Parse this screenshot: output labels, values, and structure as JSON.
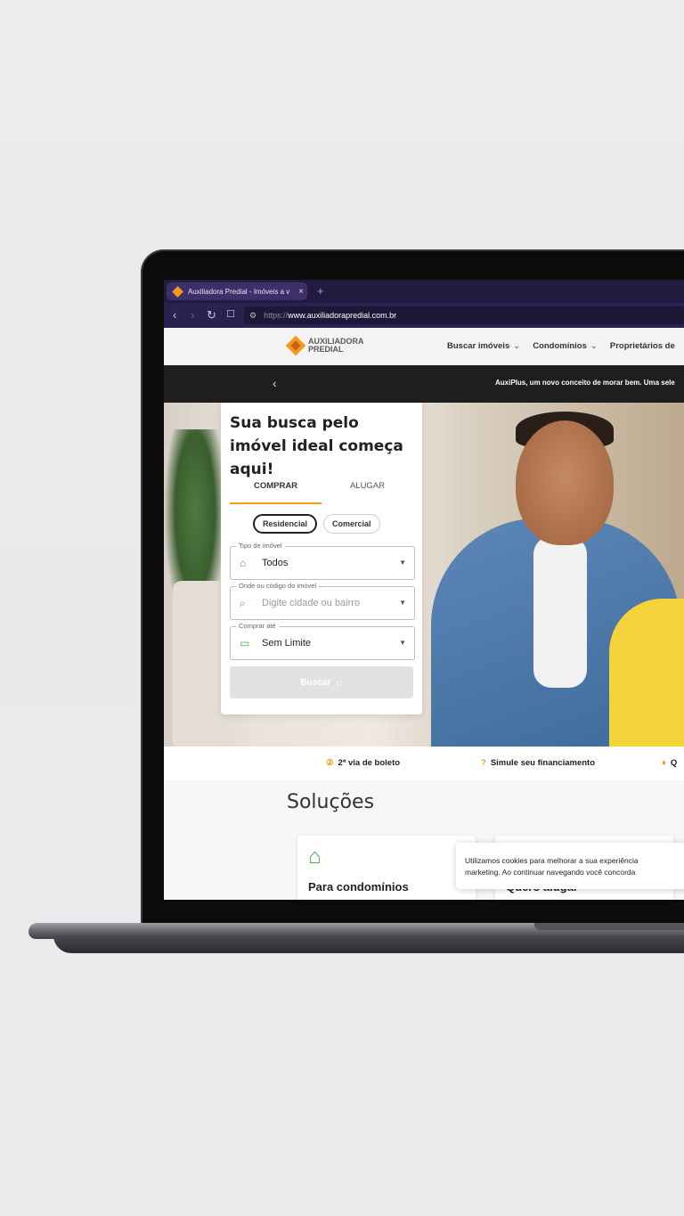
{
  "browser": {
    "tab_title": "Auxiliadora Predial - Imóveis a v",
    "tab_close": "×",
    "new_tab": "+",
    "url_proto": "https://",
    "url_host": "www.auxiliadorapredial.com.br"
  },
  "header": {
    "logo_line1": "AUXILIADORA",
    "logo_line2": "PREDIAL",
    "nav": [
      {
        "label": "Buscar imóveis",
        "chevron": "⌄"
      },
      {
        "label": "Condomínios",
        "chevron": "⌄"
      },
      {
        "label": "Proprietários de",
        "chevron": ""
      }
    ]
  },
  "promo": {
    "arrow": "‹",
    "text": "AuxiPlus, um novo conceito de morar bem. Uma sele"
  },
  "search": {
    "title": "Sua busca pelo imóvel ideal começa aqui!",
    "tabs": [
      "COMPRAR",
      "ALUGAR"
    ],
    "pills": [
      "Residencial",
      "Comercial"
    ],
    "fields": [
      {
        "label": "Tipo de imóvel",
        "value": "Todos"
      },
      {
        "label": "Onde ou código do imóvel",
        "placeholder": "Digite cidade ou bairro"
      },
      {
        "label": "Comprar até",
        "value": "Sem Limite"
      }
    ],
    "button": "Buscar"
  },
  "quick_links": [
    {
      "label": "2ª via de boleto"
    },
    {
      "label": "Simule seu financiamento"
    },
    {
      "label": "Q"
    }
  ],
  "solutions": {
    "title": "Soluções",
    "cards": [
      {
        "title": "Para condomínios"
      },
      {
        "title": "Quero alugar"
      }
    ]
  },
  "cookie": {
    "line1": "Utilizamos cookies para melhorar a sua experiência",
    "line2": "marketing. Ao continuar navegando você concorda"
  },
  "colors": {
    "accent_orange": "#f39a1e",
    "accent_green": "#4caf50",
    "browser_purple": "#231b3f"
  }
}
